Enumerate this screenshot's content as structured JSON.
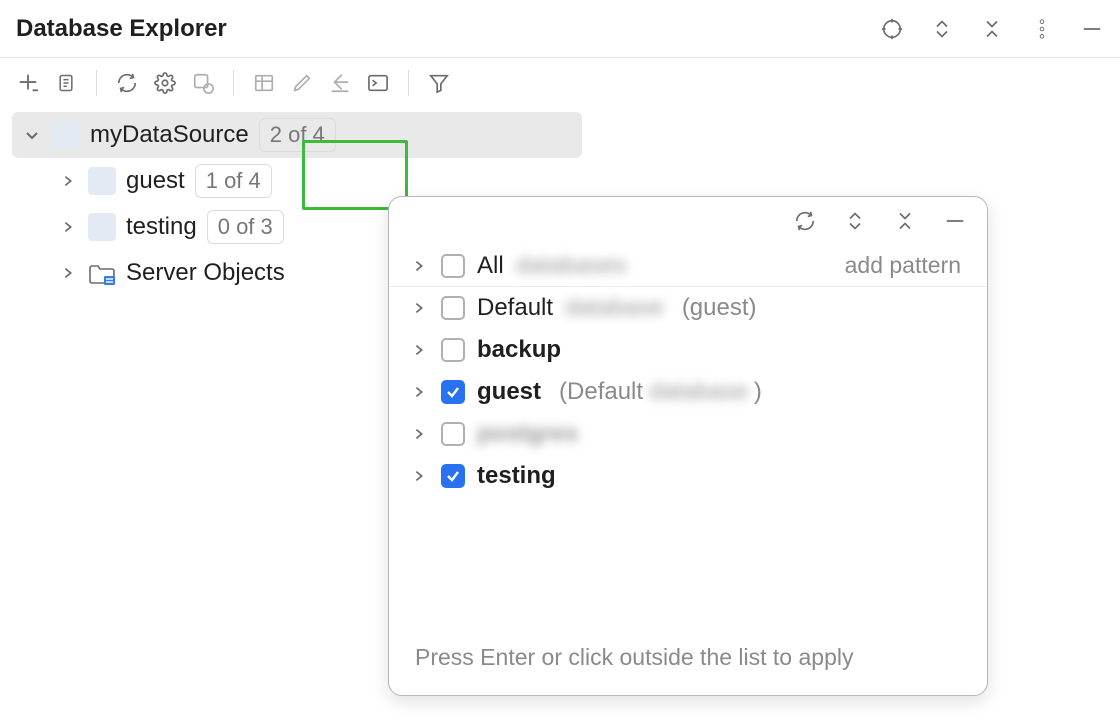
{
  "header": {
    "title": "Database Explorer"
  },
  "tree": {
    "root": {
      "label": "myDataSource",
      "badge": "2 of 4"
    },
    "children": [
      {
        "label": "guest",
        "badge": "1 of 4"
      },
      {
        "label": "testing",
        "badge": "0 of 3"
      },
      {
        "label": "Server Objects"
      }
    ]
  },
  "popup": {
    "add_pattern": "add pattern",
    "rows": [
      {
        "label": "All",
        "blurred": "databases",
        "checked": false
      },
      {
        "label": "Default",
        "blurred": "database",
        "suffix": "(guest)",
        "checked": false
      },
      {
        "label": "backup",
        "bold": true,
        "checked": false
      },
      {
        "label": "guest",
        "bold": true,
        "suffix_pre": "(Default ",
        "blurred": "database",
        "suffix_post": ")",
        "checked": true
      },
      {
        "blurred_only": "postgres",
        "checked": false
      },
      {
        "label": "testing",
        "bold": true,
        "checked": true
      }
    ],
    "footer": "Press Enter or click outside the list to apply"
  }
}
